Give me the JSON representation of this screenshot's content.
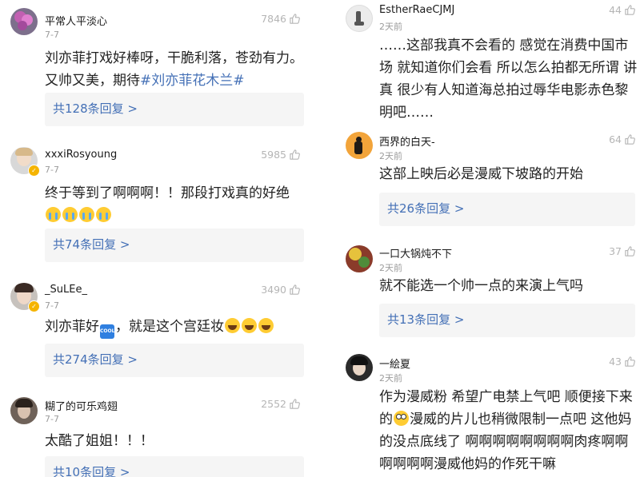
{
  "left_comments": [
    {
      "username": "平常人平淡心",
      "date": "7-7",
      "likes": "7846",
      "text_lines": [
        "刘亦菲打戏好棒呀，干脆利落，苍劲有力。",
        "又帅又美，期待"
      ],
      "hashtag": "#刘亦菲花木兰#",
      "reply": "共128条回复 >"
    },
    {
      "username": "xxxiRosyoung",
      "date": "7-7",
      "likes": "5985",
      "text_lines": [
        "终于等到了啊啊啊！！那段打戏真的好绝"
      ],
      "reply": "共74条回复 >"
    },
    {
      "username": "_SuLEe_",
      "date": "7-7",
      "likes": "3490",
      "text_before": "刘亦菲好",
      "cool_label": "COOL",
      "text_after": "，就是这个宫廷妆",
      "reply": "共274条回复 >"
    },
    {
      "username": "糊了的可乐鸡翅",
      "date": "7-7",
      "likes": "2552",
      "text_lines": [
        "太酷了姐姐！！！"
      ],
      "reply": "共10条回复 >"
    }
  ],
  "right_comments": [
    {
      "username": "EstherRaeCJMJ",
      "date": "2天前",
      "likes": "44",
      "text_lines": [
        "……这部我真不会看的 感觉在消费中国市",
        "场 就知道你们会看 所以怎么拍都无所谓 讲",
        "真 很少有人知道海总拍过辱华电影赤色黎",
        "明吧……"
      ]
    },
    {
      "username": "西界的白天-",
      "date": "2天前",
      "likes": "64",
      "text_lines": [
        "这部上映后必是漫威下坡路的开始"
      ],
      "reply": "共26条回复 >"
    },
    {
      "username": "一口大锅炖不下",
      "date": "2天前",
      "likes": "37",
      "text_lines": [
        "就不能选一个帅一点的来演上气吗"
      ],
      "reply": "共13条回复 >"
    },
    {
      "username": "一絵夏",
      "date": "2天前",
      "likes": "43",
      "text_lines": [
        "作为漫威粉 希望广电禁上气吧 顺便接下来",
        "的",
        "漫威的片儿也稍微限制一点吧 这他妈",
        "的没点底线了 啊啊啊啊啊啊啊啊肉疼啊啊",
        "啊啊啊啊漫威他妈的作死干嘛"
      ]
    }
  ],
  "colors": {
    "link": "#4470b6",
    "meta": "#9b9b9b",
    "reply_bg": "#f5f5f5"
  }
}
